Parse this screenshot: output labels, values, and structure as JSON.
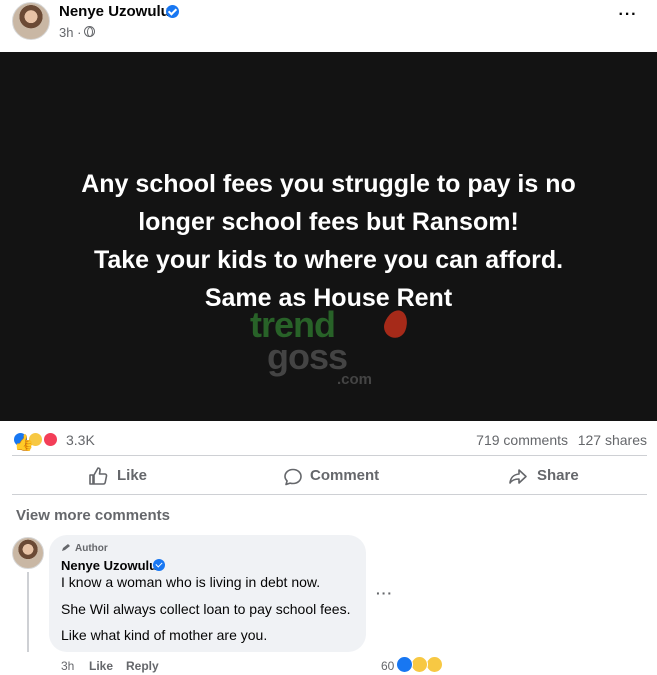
{
  "post": {
    "author_name": "Nenye Uzowulu",
    "time": "3h ·",
    "menu_icon": "more-horizontal-icon",
    "image_text_lines": [
      "Any school fees you struggle to pay is no",
      "longer school fees but Ransom!",
      "Take your kids to where you can afford.",
      "Same as House Rent"
    ],
    "watermark": {
      "line1": "trend",
      "line2": "goss",
      "line3": ".com"
    }
  },
  "stats": {
    "reactions": "3.3K",
    "comments": "719 comments",
    "shares": "127 shares",
    "reaction_icons": [
      "like-icon",
      "haha-icon",
      "love-icon"
    ]
  },
  "actions": {
    "like": "Like",
    "comment": "Comment",
    "share": "Share"
  },
  "view_more_comments": "View more comments",
  "comment": {
    "badge": "Author",
    "name": "Nenye Uzowulu",
    "lines": [
      "I know a woman who is living in debt now.",
      "She Wil always collect loan to pay school fees.",
      "Like what kind of mother are you."
    ],
    "time": "3h",
    "like_label": "Like",
    "reply_label": "Reply",
    "reaction_count": "60",
    "reaction_icons": [
      "like-icon",
      "haha-icon",
      "wow-icon"
    ]
  },
  "colors": {
    "facebook_blue": "#1877f2",
    "secondary_text": "#65676b",
    "image_bg": "#131313",
    "love_red": "#f33e58",
    "haha_yellow": "#f7c843"
  }
}
